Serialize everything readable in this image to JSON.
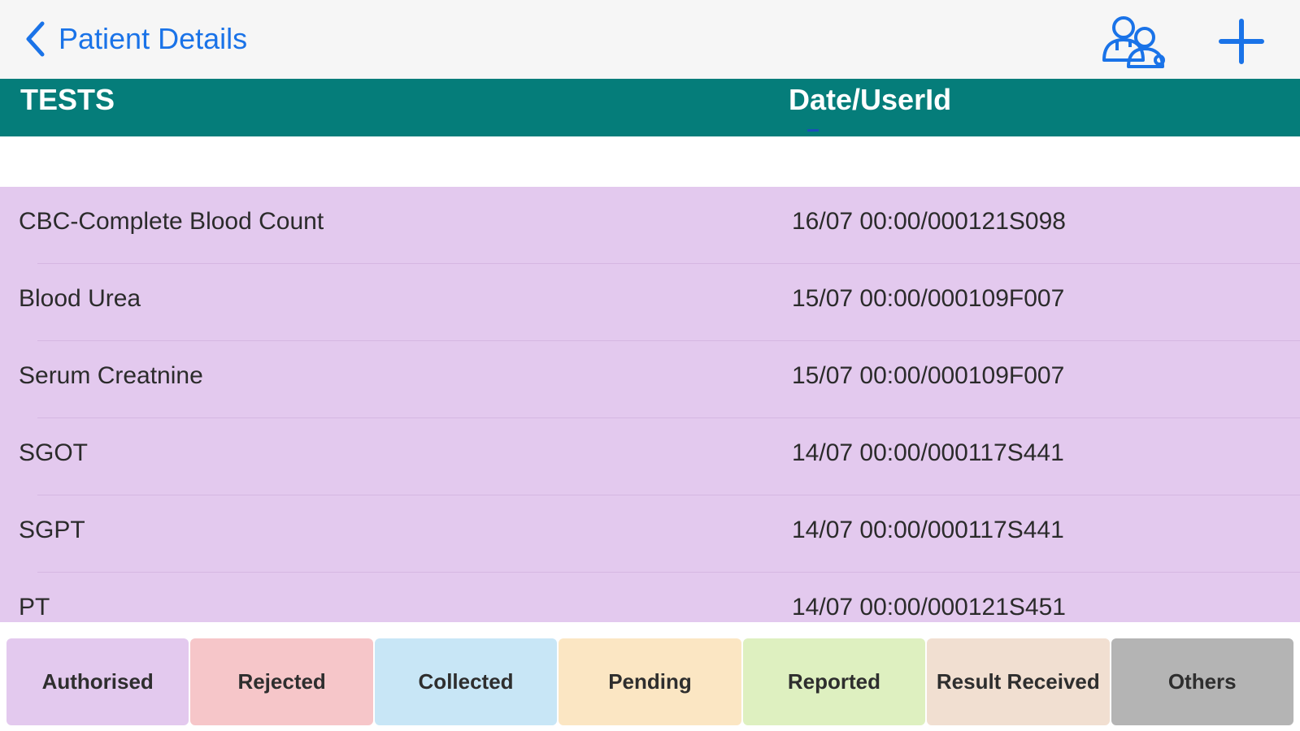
{
  "navbar": {
    "back_label": "Patient Details",
    "icons": [
      "chevron-left-icon",
      "doctors-icon",
      "plus-icon"
    ],
    "accent_color": "#1a73e8"
  },
  "table": {
    "header": {
      "tests": "TESTS",
      "date_user": "Date/UserId",
      "color": "#057d7a"
    },
    "rows": [
      {
        "test": "CBC-Complete Blood Count",
        "date_user": "16/07 00:00/000121S098"
      },
      {
        "test": "Blood Urea",
        "date_user": "15/07 00:00/000109F007"
      },
      {
        "test": "Serum Creatnine",
        "date_user": "15/07 00:00/000109F007"
      },
      {
        "test": "SGOT",
        "date_user": "14/07 00:00/000117S441"
      },
      {
        "test": "SGPT",
        "date_user": "14/07 00:00/000117S441"
      },
      {
        "test": "PT",
        "date_user": "14/07 00:00/000121S451"
      }
    ],
    "row_color": "#e3c9ee"
  },
  "legend": [
    {
      "label": "Authorised",
      "color": "#e3c9ee"
    },
    {
      "label": "Rejected",
      "color": "#f6c6c9"
    },
    {
      "label": "Collected",
      "color": "#c8e6f6"
    },
    {
      "label": "Pending",
      "color": "#fbe6c3"
    },
    {
      "label": "Reported",
      "color": "#def0c0"
    },
    {
      "label": "Result Received",
      "color": "#f1dfd1"
    },
    {
      "label": "Others",
      "color": "#b4b4b4"
    }
  ]
}
